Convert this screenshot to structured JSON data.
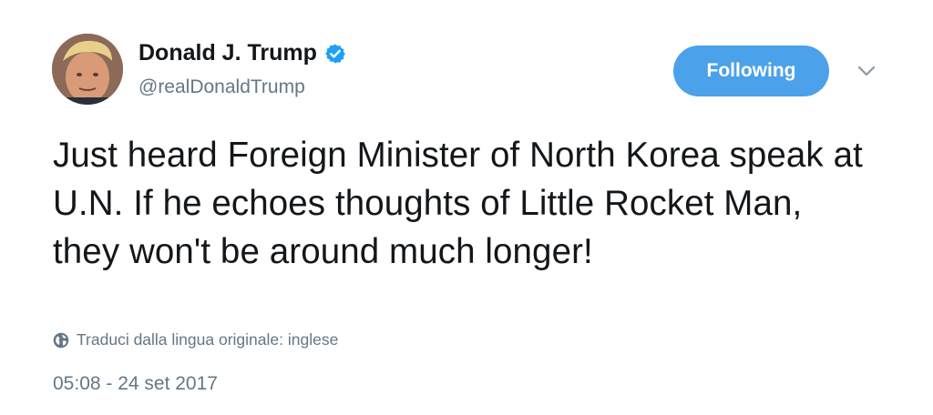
{
  "user": {
    "display_name": "Donald J. Trump",
    "handle": "@realDonaldTrump",
    "verified_icon": "verified-badge-icon"
  },
  "follow_button": {
    "label": "Following"
  },
  "menu": {
    "icon": "chevron-down-icon"
  },
  "tweet": {
    "text": "Just heard Foreign Minister of North Korea speak at U.N. If he echoes thoughts of Little Rocket Man, they won't be around much longer!"
  },
  "translate": {
    "icon": "globe-icon",
    "label": "Traduci dalla lingua originale: inglese"
  },
  "meta": {
    "timestamp": "05:08 - 24 set 2017"
  },
  "colors": {
    "accent": "#4ba1ea",
    "verified": "#1da1f2",
    "muted": "#657786",
    "text": "#14171a"
  }
}
